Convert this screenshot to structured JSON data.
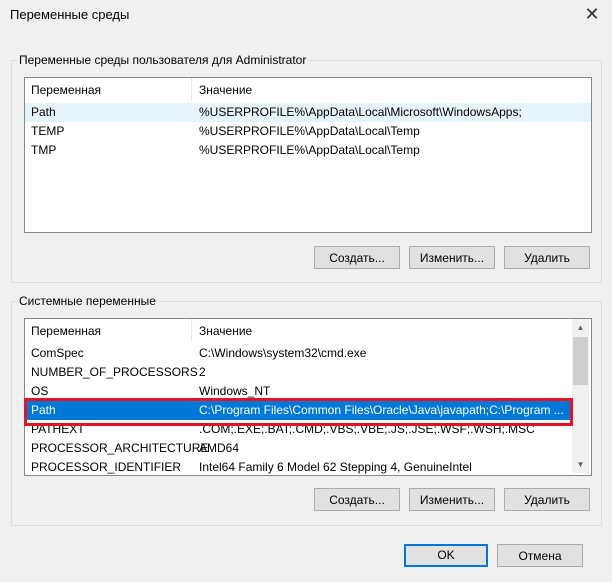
{
  "window": {
    "title": "Переменные среды",
    "close_glyph": "✕"
  },
  "user_group": {
    "label": "Переменные среды пользователя для Administrator",
    "columns": [
      "Переменная",
      "Значение"
    ],
    "rows": [
      {
        "name": "Path",
        "value": "%USERPROFILE%\\AppData\\Local\\Microsoft\\WindowsApps;"
      },
      {
        "name": "TEMP",
        "value": "%USERPROFILE%\\AppData\\Local\\Temp"
      },
      {
        "name": "TMP",
        "value": "%USERPROFILE%\\AppData\\Local\\Temp"
      }
    ],
    "buttons": {
      "create": "Создать...",
      "edit": "Изменить...",
      "delete": "Удалить"
    }
  },
  "system_group": {
    "label": "Системные переменные",
    "columns": [
      "Переменная",
      "Значение"
    ],
    "rows": [
      {
        "name": "ComSpec",
        "value": "C:\\Windows\\system32\\cmd.exe"
      },
      {
        "name": "NUMBER_OF_PROCESSORS",
        "value": "2"
      },
      {
        "name": "OS",
        "value": "Windows_NT"
      },
      {
        "name": "Path",
        "value": "C:\\Program Files\\Common Files\\Oracle\\Java\\javapath;C:\\Program ..."
      },
      {
        "name": "PATHEXT",
        "value": ".COM;.EXE;.BAT;.CMD;.VBS;.VBE;.JS;.JSE;.WSF;.WSH;.MSC"
      },
      {
        "name": "PROCESSOR_ARCHITECTURE",
        "value": "AMD64"
      },
      {
        "name": "PROCESSOR_IDENTIFIER",
        "value": "Intel64 Family 6 Model 62 Stepping 4, GenuineIntel"
      }
    ],
    "selected_row": "Path",
    "buttons": {
      "create": "Создать...",
      "edit": "Изменить...",
      "delete": "Удалить"
    }
  },
  "footer": {
    "ok": "OK",
    "cancel": "Отмена"
  },
  "colors": {
    "selection": "#0078d7",
    "highlight_box": "#e81123",
    "hover_row": "#e5f3fb"
  }
}
